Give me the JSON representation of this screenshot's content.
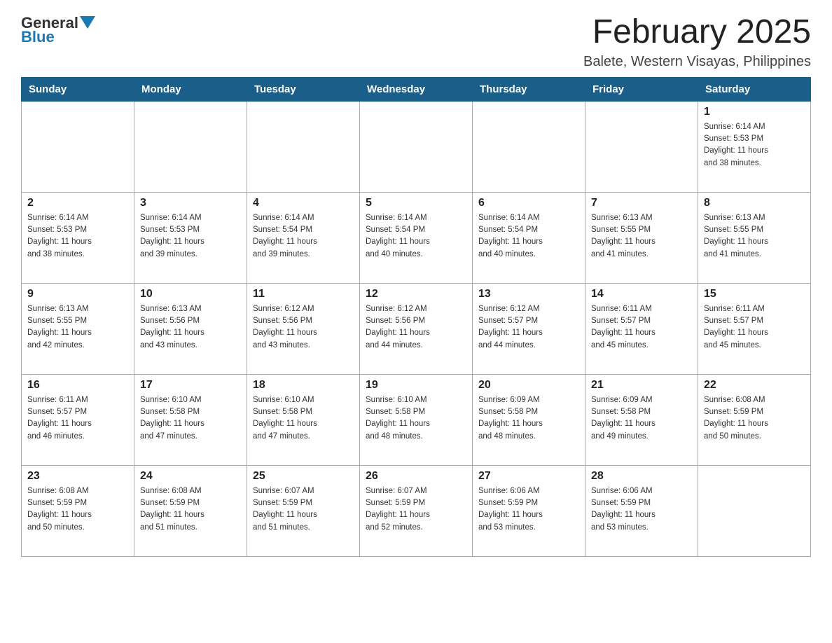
{
  "logo": {
    "general": "General",
    "blue": "Blue"
  },
  "title": "February 2025",
  "subtitle": "Balete, Western Visayas, Philippines",
  "days_of_week": [
    "Sunday",
    "Monday",
    "Tuesday",
    "Wednesday",
    "Thursday",
    "Friday",
    "Saturday"
  ],
  "weeks": [
    [
      {
        "day": "",
        "info": ""
      },
      {
        "day": "",
        "info": ""
      },
      {
        "day": "",
        "info": ""
      },
      {
        "day": "",
        "info": ""
      },
      {
        "day": "",
        "info": ""
      },
      {
        "day": "",
        "info": ""
      },
      {
        "day": "1",
        "info": "Sunrise: 6:14 AM\nSunset: 5:53 PM\nDaylight: 11 hours\nand 38 minutes."
      }
    ],
    [
      {
        "day": "2",
        "info": "Sunrise: 6:14 AM\nSunset: 5:53 PM\nDaylight: 11 hours\nand 38 minutes."
      },
      {
        "day": "3",
        "info": "Sunrise: 6:14 AM\nSunset: 5:53 PM\nDaylight: 11 hours\nand 39 minutes."
      },
      {
        "day": "4",
        "info": "Sunrise: 6:14 AM\nSunset: 5:54 PM\nDaylight: 11 hours\nand 39 minutes."
      },
      {
        "day": "5",
        "info": "Sunrise: 6:14 AM\nSunset: 5:54 PM\nDaylight: 11 hours\nand 40 minutes."
      },
      {
        "day": "6",
        "info": "Sunrise: 6:14 AM\nSunset: 5:54 PM\nDaylight: 11 hours\nand 40 minutes."
      },
      {
        "day": "7",
        "info": "Sunrise: 6:13 AM\nSunset: 5:55 PM\nDaylight: 11 hours\nand 41 minutes."
      },
      {
        "day": "8",
        "info": "Sunrise: 6:13 AM\nSunset: 5:55 PM\nDaylight: 11 hours\nand 41 minutes."
      }
    ],
    [
      {
        "day": "9",
        "info": "Sunrise: 6:13 AM\nSunset: 5:55 PM\nDaylight: 11 hours\nand 42 minutes."
      },
      {
        "day": "10",
        "info": "Sunrise: 6:13 AM\nSunset: 5:56 PM\nDaylight: 11 hours\nand 43 minutes."
      },
      {
        "day": "11",
        "info": "Sunrise: 6:12 AM\nSunset: 5:56 PM\nDaylight: 11 hours\nand 43 minutes."
      },
      {
        "day": "12",
        "info": "Sunrise: 6:12 AM\nSunset: 5:56 PM\nDaylight: 11 hours\nand 44 minutes."
      },
      {
        "day": "13",
        "info": "Sunrise: 6:12 AM\nSunset: 5:57 PM\nDaylight: 11 hours\nand 44 minutes."
      },
      {
        "day": "14",
        "info": "Sunrise: 6:11 AM\nSunset: 5:57 PM\nDaylight: 11 hours\nand 45 minutes."
      },
      {
        "day": "15",
        "info": "Sunrise: 6:11 AM\nSunset: 5:57 PM\nDaylight: 11 hours\nand 45 minutes."
      }
    ],
    [
      {
        "day": "16",
        "info": "Sunrise: 6:11 AM\nSunset: 5:57 PM\nDaylight: 11 hours\nand 46 minutes."
      },
      {
        "day": "17",
        "info": "Sunrise: 6:10 AM\nSunset: 5:58 PM\nDaylight: 11 hours\nand 47 minutes."
      },
      {
        "day": "18",
        "info": "Sunrise: 6:10 AM\nSunset: 5:58 PM\nDaylight: 11 hours\nand 47 minutes."
      },
      {
        "day": "19",
        "info": "Sunrise: 6:10 AM\nSunset: 5:58 PM\nDaylight: 11 hours\nand 48 minutes."
      },
      {
        "day": "20",
        "info": "Sunrise: 6:09 AM\nSunset: 5:58 PM\nDaylight: 11 hours\nand 48 minutes."
      },
      {
        "day": "21",
        "info": "Sunrise: 6:09 AM\nSunset: 5:58 PM\nDaylight: 11 hours\nand 49 minutes."
      },
      {
        "day": "22",
        "info": "Sunrise: 6:08 AM\nSunset: 5:59 PM\nDaylight: 11 hours\nand 50 minutes."
      }
    ],
    [
      {
        "day": "23",
        "info": "Sunrise: 6:08 AM\nSunset: 5:59 PM\nDaylight: 11 hours\nand 50 minutes."
      },
      {
        "day": "24",
        "info": "Sunrise: 6:08 AM\nSunset: 5:59 PM\nDaylight: 11 hours\nand 51 minutes."
      },
      {
        "day": "25",
        "info": "Sunrise: 6:07 AM\nSunset: 5:59 PM\nDaylight: 11 hours\nand 51 minutes."
      },
      {
        "day": "26",
        "info": "Sunrise: 6:07 AM\nSunset: 5:59 PM\nDaylight: 11 hours\nand 52 minutes."
      },
      {
        "day": "27",
        "info": "Sunrise: 6:06 AM\nSunset: 5:59 PM\nDaylight: 11 hours\nand 53 minutes."
      },
      {
        "day": "28",
        "info": "Sunrise: 6:06 AM\nSunset: 5:59 PM\nDaylight: 11 hours\nand 53 minutes."
      },
      {
        "day": "",
        "info": ""
      }
    ]
  ]
}
